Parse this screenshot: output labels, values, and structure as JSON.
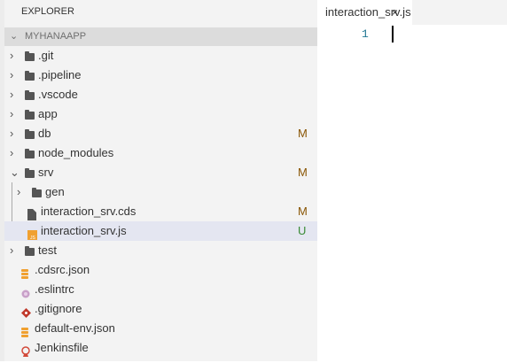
{
  "sidebar": {
    "title": "EXPLORER",
    "root": "MYHANAAPP",
    "items": [
      {
        "label": ".git",
        "type": "folder",
        "depth": 0
      },
      {
        "label": ".pipeline",
        "type": "folder",
        "depth": 0
      },
      {
        "label": ".vscode",
        "type": "folder",
        "depth": 0
      },
      {
        "label": "app",
        "type": "folder",
        "depth": 0
      },
      {
        "label": "db",
        "type": "folder",
        "depth": 0,
        "status": "M"
      },
      {
        "label": "node_modules",
        "type": "folder",
        "depth": 0
      },
      {
        "label": "srv",
        "type": "folder",
        "depth": 0,
        "expanded": true,
        "status": "M"
      },
      {
        "label": "gen",
        "type": "folder",
        "depth": 1
      },
      {
        "label": "interaction_srv.cds",
        "type": "file",
        "depth": 1,
        "status": "M"
      },
      {
        "label": "interaction_srv.js",
        "type": "js",
        "depth": 1,
        "status": "U",
        "selected": true
      },
      {
        "label": "test",
        "type": "folder",
        "depth": 0
      },
      {
        "label": ".cdsrc.json",
        "type": "json",
        "depth": 0
      },
      {
        "label": ".eslintrc",
        "type": "eslint",
        "depth": 0
      },
      {
        "label": ".gitignore",
        "type": "git",
        "depth": 0
      },
      {
        "label": "default-env.json",
        "type": "json",
        "depth": 0
      },
      {
        "label": "Jenkinsfile",
        "type": "jenkins",
        "depth": 0
      }
    ]
  },
  "colors": {
    "modified": "#895503",
    "untracked": "#388a34"
  },
  "editor": {
    "tab_label": "interaction_srv.js",
    "close_icon": "×",
    "line_number": "1"
  }
}
